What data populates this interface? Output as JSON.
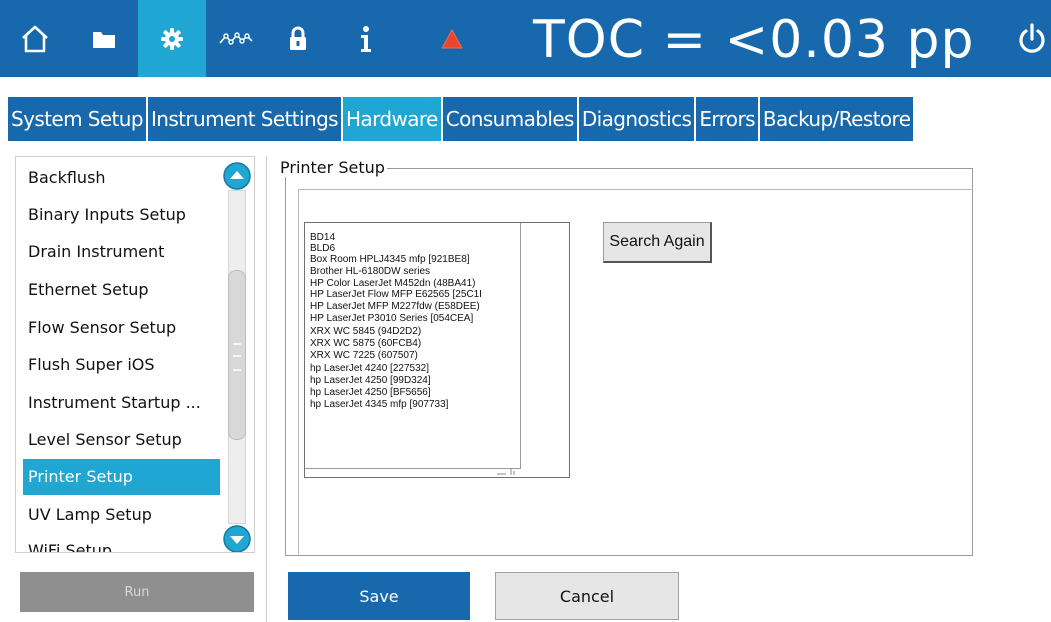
{
  "topbar": {
    "status_text": "TOC = <0.03 pp",
    "buttons": [
      {
        "icon": "home-icon",
        "active": false
      },
      {
        "icon": "folder-icon",
        "active": false
      },
      {
        "icon": "gear-icon",
        "active": true
      },
      {
        "icon": "trend-icon",
        "active": false
      },
      {
        "icon": "lock-icon",
        "active": false
      },
      {
        "icon": "info-icon",
        "active": false
      },
      {
        "icon": "alert-icon",
        "active": false
      }
    ],
    "power_icon": "power-icon"
  },
  "tabs": [
    "System Setup",
    "Instrument Settings",
    "Hardware",
    "Consumables",
    "Diagnostics",
    "Errors",
    "Backup/Restore"
  ],
  "active_tab": "Hardware",
  "sidebar": {
    "items": [
      "Backflush",
      "Binary Inputs Setup",
      "Drain Instrument",
      "Ethernet Setup",
      "Flow Sensor Setup",
      "Flush Super iOS",
      "Instrument Startup ...",
      "Level Sensor Setup",
      "Printer Setup",
      "UV Lamp Setup",
      "WiFi Setup"
    ],
    "selected": "Printer Setup",
    "run_label": "Run"
  },
  "printer_setup": {
    "title": "Printer Setup",
    "printers": [
      "BD14",
      "BLD6",
      "Box Room HPLJ4345 mfp [921BE8]",
      "Brother HL-6180DW series",
      "HP Color LaserJet M452dn (48BA41)",
      "HP LaserJet Flow MFP E62565 [25C1I",
      "HP LaserJet MFP M227fdw (E58DEE)",
      "HP LaserJet P3010 Series [054CEA]",
      "XRX WC 5845 (94D2D2)",
      "XRX WC 5875 (60FCB4)",
      "XRX WC 7225 (607507)",
      "hp LaserJet 4240 [227532]",
      "hp LaserJet 4250 [99D324]",
      "hp LaserJet 4250 [BF5656]",
      "hp LaserJet 4345 mfp [907733]"
    ],
    "search_label": "Search Again",
    "save_label": "Save",
    "cancel_label": "Cancel"
  },
  "colors": {
    "primary_blue": "#1768ac",
    "active_cyan": "#1fa6d2",
    "alert_red": "#e8452c",
    "disabled_gray": "#8f8f8f"
  }
}
